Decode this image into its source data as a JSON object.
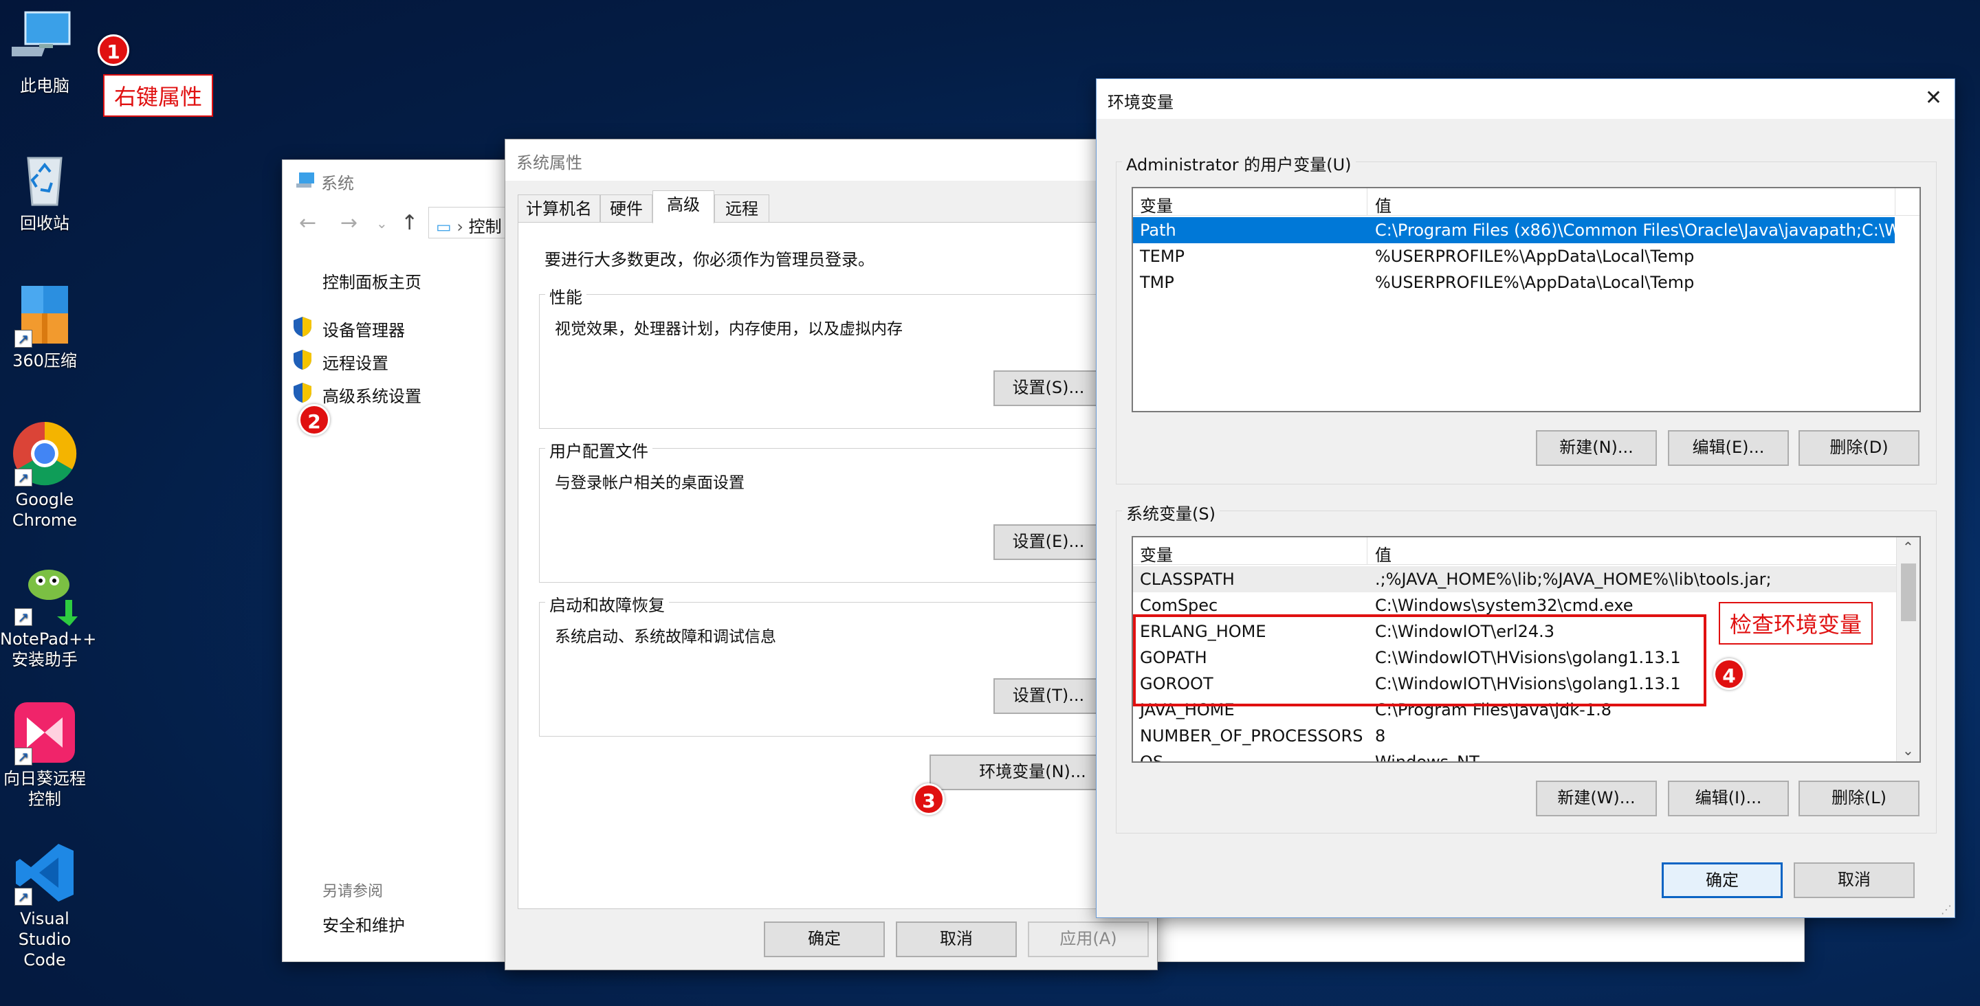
{
  "desktop": {
    "icons": [
      {
        "label": "此电脑"
      },
      {
        "label": "回收站"
      },
      {
        "label": "360压缩"
      },
      {
        "label": "Google Chrome"
      },
      {
        "label": "NotePad++ 安装助手"
      },
      {
        "label": "向日葵远程控制"
      },
      {
        "label": "Visual Studio Code"
      }
    ]
  },
  "annotations": {
    "badge1": "1",
    "note1": "右键属性",
    "badge2": "2",
    "badge3": "3",
    "badge4": "4",
    "note4": "检查环境变量"
  },
  "system_window": {
    "title": "系统",
    "address": "控制",
    "home_link": "控制面板主页",
    "links": [
      "设备管理器",
      "远程设置",
      "高级系统设置"
    ],
    "see_also_title": "另请参阅",
    "see_also_link": "安全和维护"
  },
  "sysprops": {
    "title": "系统属性",
    "tabs": [
      "计算机名",
      "硬件",
      "高级",
      "远程"
    ],
    "active_tab": "高级",
    "admin_note": "要进行大多数更改，你必须作为管理员登录。",
    "performance": {
      "title": "性能",
      "desc": "视觉效果，处理器计划，内存使用，以及虚拟内存",
      "button": "设置(S)..."
    },
    "profiles": {
      "title": "用户配置文件",
      "desc": "与登录帐户相关的桌面设置",
      "button": "设置(E)..."
    },
    "startup": {
      "title": "启动和故障恢复",
      "desc": "系统启动、系统故障和调试信息",
      "button": "设置(T)..."
    },
    "env_button": "环境变量(N)...",
    "ok": "确定",
    "cancel": "取消",
    "apply": "应用(A)"
  },
  "envvars": {
    "title": "环境变量",
    "close": "✕",
    "user_group": "Administrator 的用户变量(U)",
    "col_var": "变量",
    "col_val": "值",
    "user_rows": [
      {
        "name": "Path",
        "value": "C:\\Program Files (x86)\\Common Files\\Oracle\\Java\\javapath;C:\\W..."
      },
      {
        "name": "TEMP",
        "value": "%USERPROFILE%\\AppData\\Local\\Temp"
      },
      {
        "name": "TMP",
        "value": "%USERPROFILE%\\AppData\\Local\\Temp"
      }
    ],
    "user_buttons": {
      "new": "新建(N)...",
      "edit": "编辑(E)...",
      "delete": "删除(D)"
    },
    "sys_group": "系统变量(S)",
    "sys_rows": [
      {
        "name": "CLASSPATH",
        "value": ".;%JAVA_HOME%\\lib;%JAVA_HOME%\\lib\\tools.jar;"
      },
      {
        "name": "ComSpec",
        "value": "C:\\Windows\\system32\\cmd.exe"
      },
      {
        "name": "ERLANG_HOME",
        "value": "C:\\WindowIOT\\erl24.3"
      },
      {
        "name": "GOPATH",
        "value": "C:\\WindowIOT\\HVisions\\golang1.13.1"
      },
      {
        "name": "GOROOT",
        "value": "C:\\WindowIOT\\HVisions\\golang1.13.1"
      },
      {
        "name": "JAVA_HOME",
        "value": "C:\\Program Files\\Java\\jdk-1.8"
      },
      {
        "name": "NUMBER_OF_PROCESSORS",
        "value": "8"
      },
      {
        "name": "OS",
        "value": "Windows_NT"
      }
    ],
    "sys_buttons": {
      "new": "新建(W)...",
      "edit": "编辑(I)...",
      "delete": "删除(L)"
    },
    "ok": "确定",
    "cancel": "取消"
  }
}
